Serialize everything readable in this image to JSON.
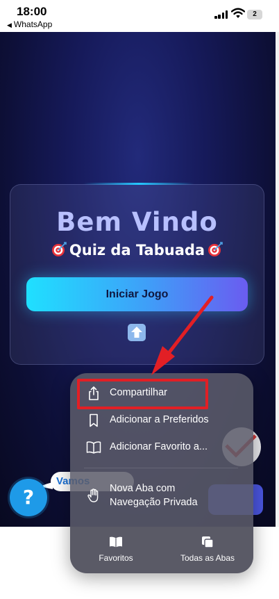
{
  "status_bar": {
    "time": "18:00",
    "back_app": "WhatsApp",
    "battery": "2"
  },
  "page": {
    "welcome_title": "Bem Vindo",
    "quiz_title": "Quiz da Tabuada",
    "start_button": "Iniciar Jogo",
    "help_symbol": "?",
    "help_tooltip": "Vamos"
  },
  "share_menu": {
    "items": [
      {
        "label": "Compartilhar",
        "icon": "share-icon"
      },
      {
        "label": "Adicionar a Preferidos",
        "icon": "bookmark-icon"
      },
      {
        "label": "Adicionar Favorito a...",
        "icon": "book-icon"
      },
      {
        "label_line1": "Nova Aba com",
        "label_line2": "Navegação Privada",
        "icon": "hand-icon"
      }
    ],
    "footer": [
      {
        "label": "Favoritos",
        "icon": "book-icon"
      },
      {
        "label": "Todas as Abas",
        "icon": "tabs-icon"
      }
    ]
  },
  "colors": {
    "accent_cyan": "#1fe0ff",
    "accent_purple": "#6a5cf0",
    "annotation_red": "#e21f25",
    "help_blue": "#1e9ae8"
  }
}
